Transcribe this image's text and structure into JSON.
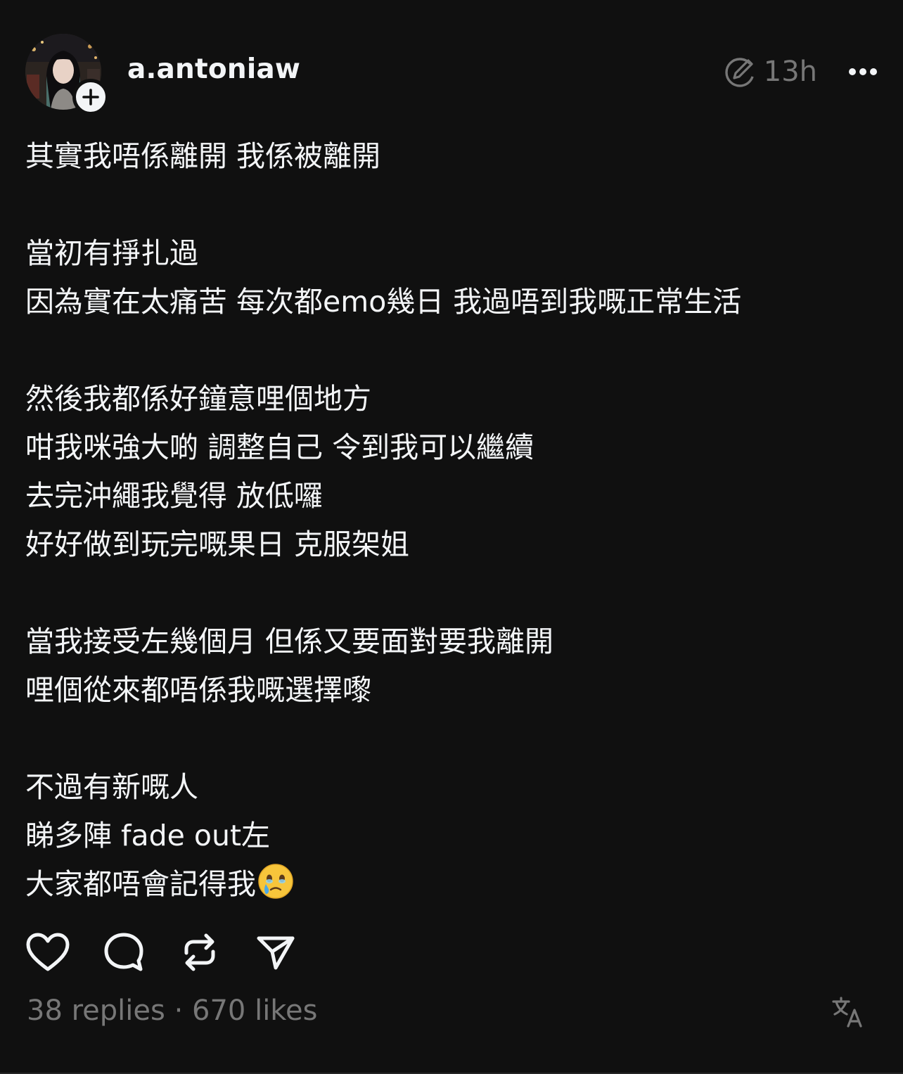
{
  "post": {
    "username": "a.antoniaw",
    "time": "13h",
    "lines": [
      "其實我唔係離開 我係被離開",
      "",
      "當初有掙扎過",
      "因為實在太痛苦 每次都emo幾日 我過唔到我嘅正常生活",
      "",
      "然後我都係好鐘意哩個地方",
      "咁我咪強大啲 調整自己 令到我可以繼續",
      "去完沖繩我覺得 放低囉",
      "好好做到玩完嘅果日 克服架姐",
      "",
      "當我接受左幾個月 但係又要面對要我離開",
      "哩個從來都唔係我嘅選擇嚟",
      "",
      "不過有新嘅人",
      "睇多陣 fade out左",
      "大家都唔會記得我"
    ],
    "stats": {
      "replies": "38 replies",
      "separator": " · ",
      "likes": "670 likes"
    }
  },
  "icons": {
    "avatar": "profile-photo",
    "follow": "plus-icon",
    "edited": "edited-pencil-icon",
    "more": "more-dots-icon",
    "emoji": "face-holding-back-tears-emoji",
    "like": "heart-icon",
    "reply": "comment-bubble-icon",
    "repost": "repost-icon",
    "share": "send-icon",
    "translate": "translate-icon"
  },
  "colors": {
    "background": "#101010",
    "text": "#f3f5f7",
    "secondary": "#777777"
  }
}
